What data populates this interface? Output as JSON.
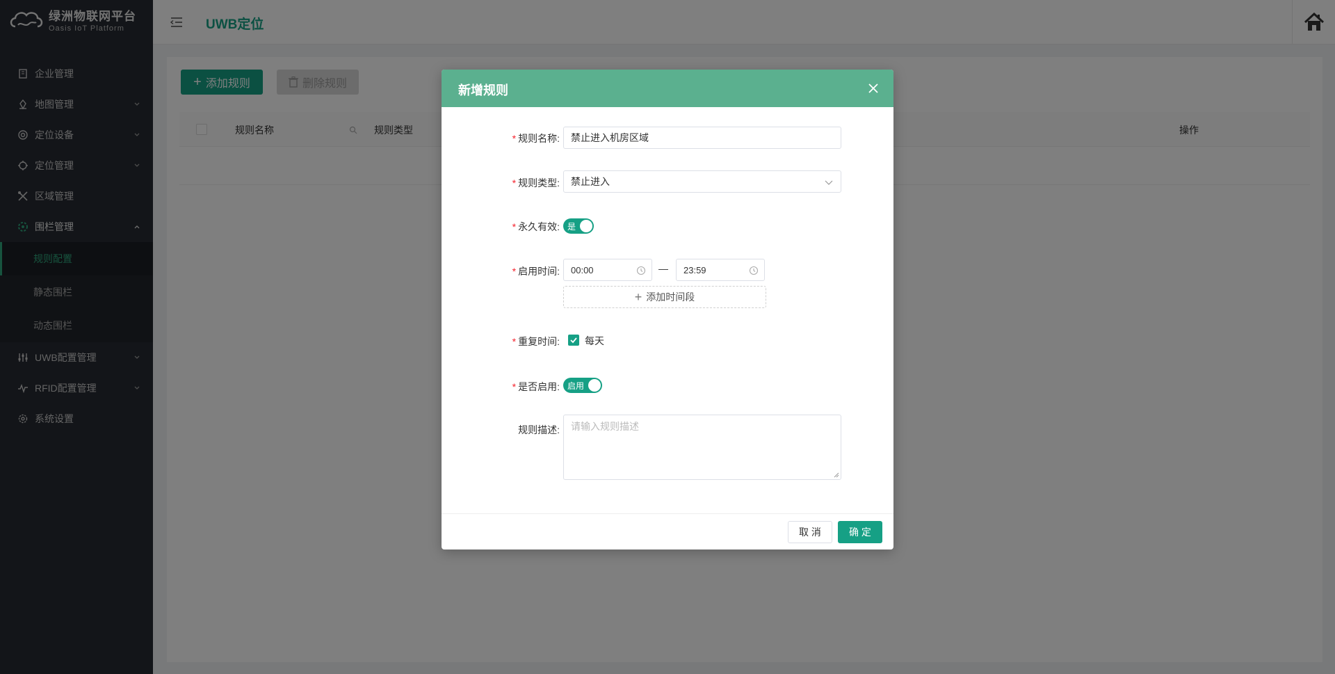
{
  "logo": {
    "title": "绿洲物联网平台",
    "subtitle": "Oasis IoT Platform"
  },
  "header": {
    "title": "UWB定位"
  },
  "sidebar": {
    "items": [
      {
        "label": "企业管理",
        "icon": "building-icon"
      },
      {
        "label": "地图管理",
        "icon": "map-icon"
      },
      {
        "label": "定位设备",
        "icon": "target-icon"
      },
      {
        "label": "定位管理",
        "icon": "locate-icon"
      },
      {
        "label": "区域管理",
        "icon": "area-icon"
      },
      {
        "label": "围栏管理",
        "icon": "fence-icon"
      },
      {
        "label": "UWB配置管理",
        "icon": "sliders-icon"
      },
      {
        "label": "RFID配置管理",
        "icon": "signal-icon"
      },
      {
        "label": "系统设置",
        "icon": "gear-icon"
      }
    ],
    "fence_submenu": [
      "规则配置",
      "静态围栏",
      "动态围栏"
    ]
  },
  "toolbar": {
    "add_label": "添加规则",
    "delete_label": "删除规则"
  },
  "table": {
    "columns": [
      "规则名称",
      "规则类型",
      "操作"
    ]
  },
  "modal": {
    "title": "新增规则",
    "fields": {
      "name_label": "规则名称:",
      "name_value": "禁止进入机房区域",
      "type_label": "规则类型:",
      "type_value": "禁止进入",
      "permanent_label": "永久有效:",
      "permanent_switch": "是",
      "time_label": "启用时间:",
      "time_start": "00:00",
      "time_sep": "—",
      "time_end": "23:59",
      "add_period": "添加时间段",
      "repeat_label": "重复时间:",
      "repeat_option": "每天",
      "enable_label": "是否启用:",
      "enable_switch": "启用",
      "desc_label": "规则描述:",
      "desc_placeholder": "请输入规则描述"
    },
    "cancel": "取 消",
    "ok": "确 定"
  },
  "colors": {
    "primary": "#16a085",
    "modal_header": "#5bb08f",
    "sidebar_bg": "#272b33",
    "required": "#f5222d"
  }
}
